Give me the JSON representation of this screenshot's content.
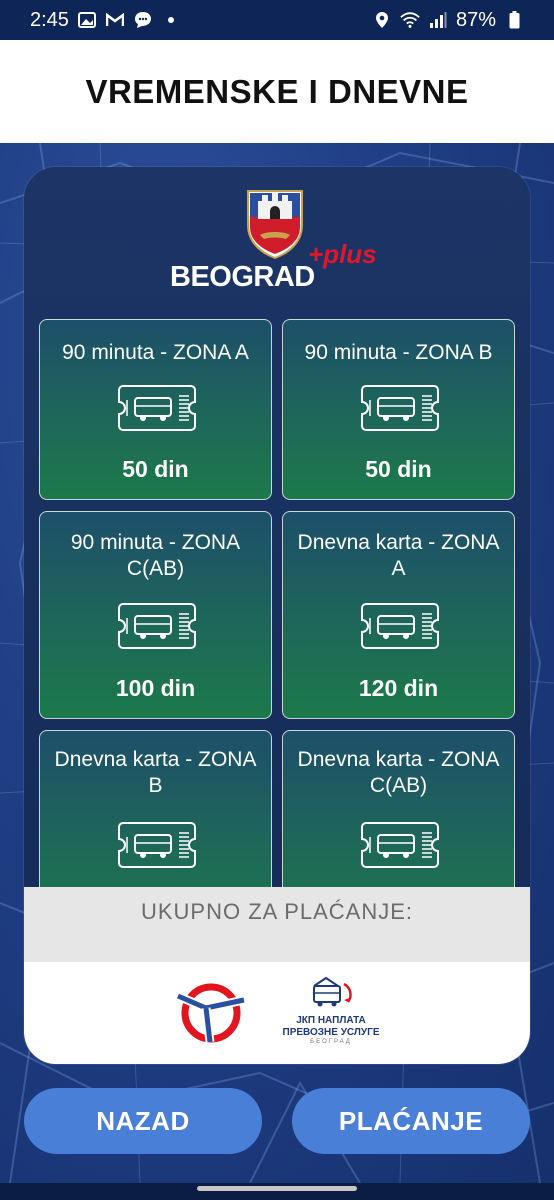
{
  "status": {
    "time": "2:45",
    "battery": "87%",
    "icons": [
      "gallery-icon",
      "gmail-icon",
      "chat-icon",
      "dot-icon",
      "location-icon",
      "wifi-icon",
      "signal-icon",
      "battery-icon"
    ]
  },
  "header": {
    "title": "VREMENSKE I DNEVNE"
  },
  "brand": {
    "name": "BEOGRAD",
    "suffix": "+plus"
  },
  "tickets": [
    {
      "title": "90 minuta - ZONA A",
      "price": "50 din"
    },
    {
      "title": "90 minuta - ZONA B",
      "price": "50 din"
    },
    {
      "title": "90 minuta - ZONA C(AB)",
      "price": "100 din"
    },
    {
      "title": "Dnevna karta - ZONA A",
      "price": "120 din"
    },
    {
      "title": "Dnevna karta - ZONA B",
      "price": ""
    },
    {
      "title": "Dnevna karta - ZONA C(AB)",
      "price": ""
    }
  ],
  "total": {
    "label": "UKUPNO ZA PLAĆANJE:"
  },
  "partners": {
    "jkp_line1": "ЈКП НАПЛАТА",
    "jkp_line2": "ПРЕВОЗНЕ УСЛУГЕ",
    "jkp_line3": "БЕОГРАД"
  },
  "buttons": {
    "back": "NAZAD",
    "pay": "PLAĆANJE"
  },
  "colors": {
    "accent_button": "#4a7fd8",
    "tile_gradient_bottom": "#1c7a4a",
    "brand_red": "#e0162b"
  }
}
